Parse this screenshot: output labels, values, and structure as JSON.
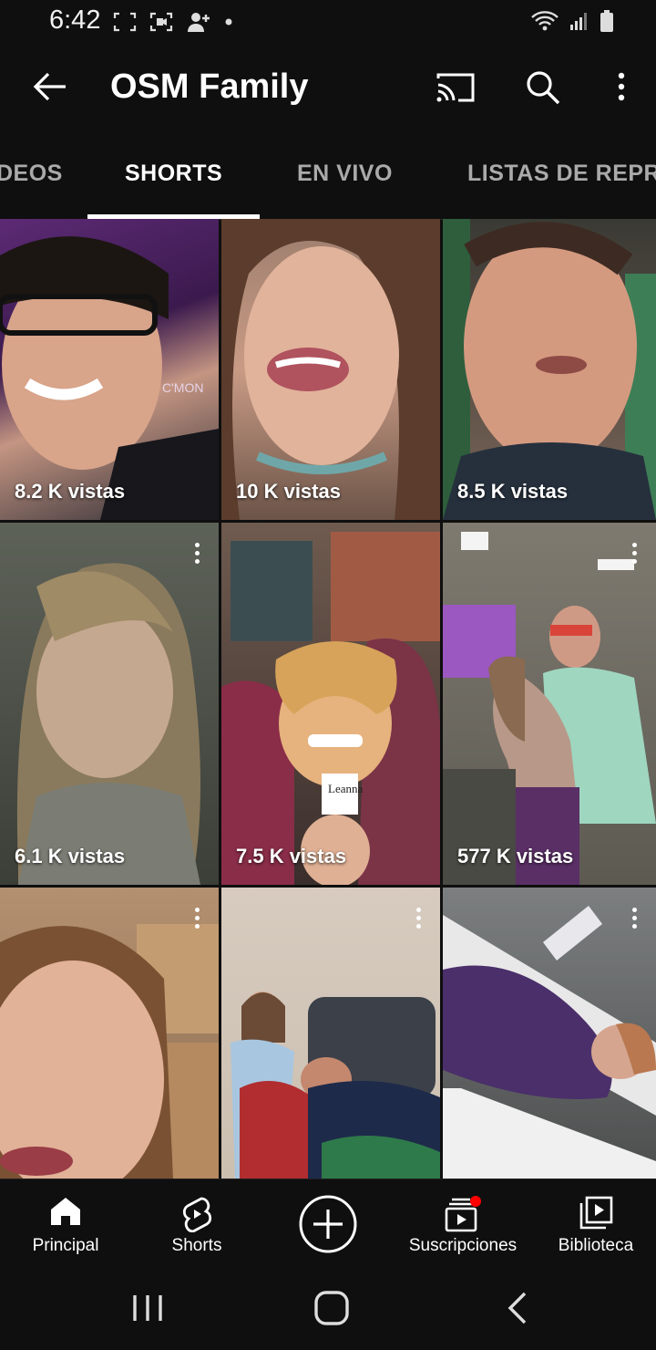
{
  "status_bar": {
    "time": "6:42"
  },
  "app_bar": {
    "title": "OSM Family"
  },
  "tabs": [
    {
      "label": "VIDEOS",
      "visible_text": "DEOS"
    },
    {
      "label": "SHORTS",
      "active": true
    },
    {
      "label": "EN VIVO"
    },
    {
      "label": "LISTAS DE REPR"
    }
  ],
  "shorts": [
    {
      "views": "8.2 K vistas"
    },
    {
      "views": "10 K vistas"
    },
    {
      "views": "8.5 K vistas"
    },
    {
      "views": "6.1 K vistas"
    },
    {
      "views": "7.5 K vistas"
    },
    {
      "views": "577 K vistas"
    },
    {
      "views": ""
    },
    {
      "views": ""
    },
    {
      "views": ""
    }
  ],
  "bottom_nav": {
    "home": "Principal",
    "shorts": "Shorts",
    "subscriptions": "Suscripciones",
    "library": "Biblioteca"
  },
  "colors": {
    "background": "#0f0f0f",
    "notification_dot": "#ff0000"
  }
}
